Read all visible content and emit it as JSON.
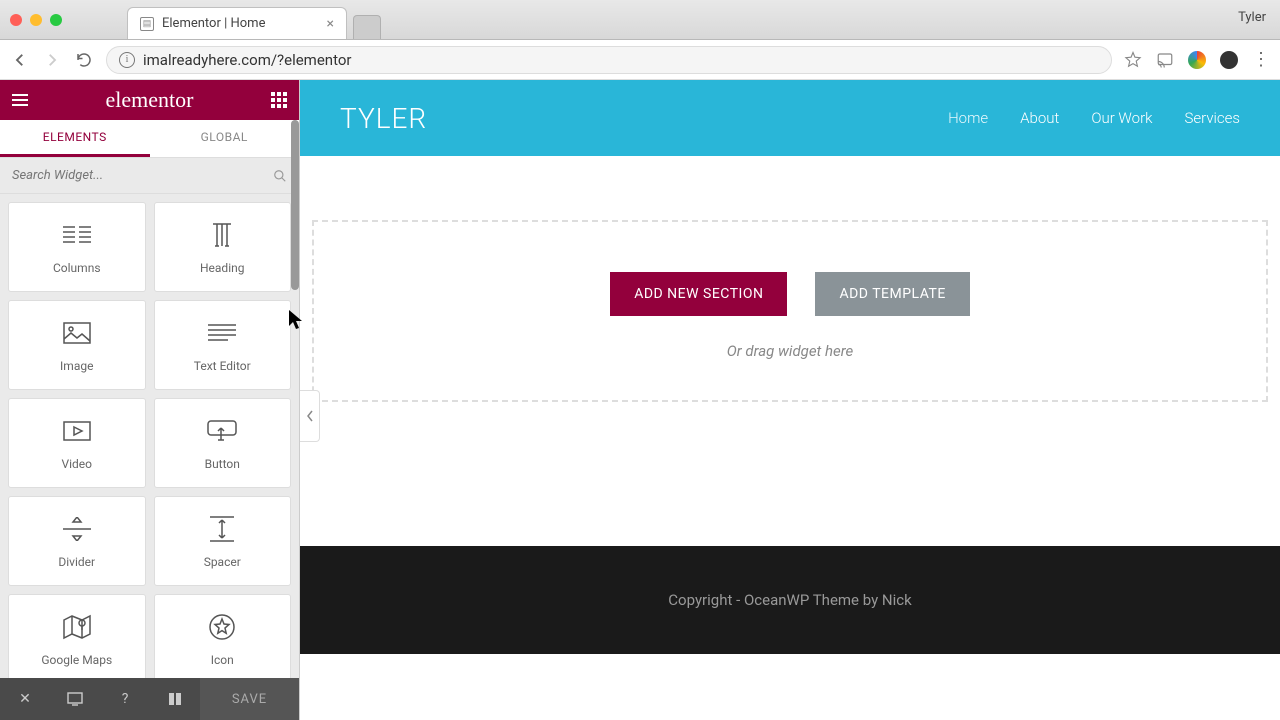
{
  "window": {
    "profile_name": "Tyler",
    "tab_title": "Elementor | Home"
  },
  "url_bar": {
    "url": "imalreadyhere.com/?elementor"
  },
  "panel": {
    "logo": "elementor",
    "tabs": {
      "elements": "ELEMENTS",
      "global": "GLOBAL"
    },
    "search_placeholder": "Search Widget...",
    "widgets": [
      {
        "label": "Columns",
        "icon": "columns"
      },
      {
        "label": "Heading",
        "icon": "heading"
      },
      {
        "label": "Image",
        "icon": "image"
      },
      {
        "label": "Text Editor",
        "icon": "text-editor"
      },
      {
        "label": "Video",
        "icon": "video"
      },
      {
        "label": "Button",
        "icon": "button"
      },
      {
        "label": "Divider",
        "icon": "divider"
      },
      {
        "label": "Spacer",
        "icon": "spacer"
      },
      {
        "label": "Google Maps",
        "icon": "maps"
      },
      {
        "label": "Icon",
        "icon": "icon"
      }
    ],
    "save_label": "SAVE"
  },
  "site": {
    "title": "TYLER",
    "nav": [
      "Home",
      "About",
      "Our Work",
      "Services"
    ],
    "drop": {
      "add_section": "ADD NEW SECTION",
      "add_template": "ADD TEMPLATE",
      "hint": "Or drag widget here"
    },
    "footer": "Copyright - OceanWP Theme by Nick"
  }
}
